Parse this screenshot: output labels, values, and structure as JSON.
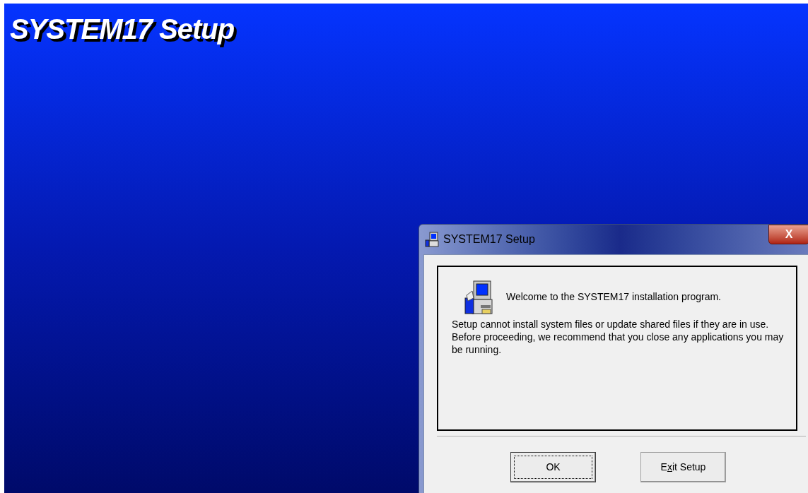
{
  "banner": {
    "title": "SYSTEM17 Setup"
  },
  "dialog": {
    "title": "SYSTEM17 Setup",
    "close": "X",
    "welcome": "Welcome to the SYSTEM17 installation program.",
    "message": "Setup cannot install system files or update shared files if they are in use. Before proceeding, we recommend that you close any applications you may be running.",
    "buttons": [
      {
        "label_parts": [
          "OK"
        ],
        "default": true
      },
      {
        "label_parts": [
          "E",
          "x",
          "it Setup"
        ],
        "default": false
      }
    ]
  }
}
